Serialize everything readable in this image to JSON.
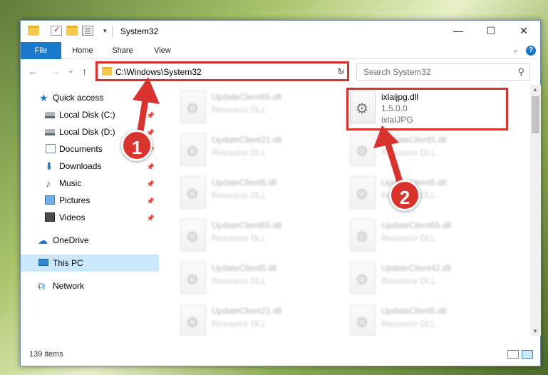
{
  "window": {
    "title": "System32",
    "controls": {
      "minimize": "—",
      "maximize": "☐",
      "close": "✕"
    }
  },
  "ribbon": {
    "tabs": [
      "File",
      "Home",
      "Share",
      "View"
    ],
    "expand": "⌄",
    "help": "?"
  },
  "navigation": {
    "back": "←",
    "forward": "→",
    "recent": "⌄",
    "up": "↑",
    "address": "C:\\Windows\\System32",
    "address_dropdown": "⌄",
    "refresh": "↻",
    "search_placeholder": "Search System32",
    "search_icon": "⚲"
  },
  "sidebar": {
    "items": [
      {
        "label": "Quick access",
        "icon": "star-icon",
        "glyph": "★"
      },
      {
        "label": "Local Disk (C:)",
        "icon": "disk-icon",
        "glyph": ""
      },
      {
        "label": "Local Disk (D:)",
        "icon": "disk-icon",
        "glyph": ""
      },
      {
        "label": "Documents",
        "icon": "document-icon",
        "glyph": ""
      },
      {
        "label": "Downloads",
        "icon": "download-icon",
        "glyph": "⬇"
      },
      {
        "label": "Music",
        "icon": "music-icon",
        "glyph": "♪"
      },
      {
        "label": "Pictures",
        "icon": "picture-icon",
        "glyph": ""
      },
      {
        "label": "Videos",
        "icon": "video-icon",
        "glyph": ""
      },
      {
        "label": "OneDrive",
        "icon": "cloud-icon",
        "glyph": "☁"
      },
      {
        "label": "This PC",
        "icon": "computer-icon",
        "glyph": ""
      },
      {
        "label": "Network",
        "icon": "network-icon",
        "glyph": "⧉"
      }
    ],
    "pin_glyph": "📌"
  },
  "files": {
    "selected": {
      "name": "ixlaijpg.dll",
      "version": "1.5.0.0",
      "description": "ixlaIJPG"
    },
    "left_column": [
      {
        "name": "UpdateClient65.dll",
        "type": "Resource DLL"
      },
      {
        "name": "UpdateClient21.dll",
        "type": "Resource DLL"
      },
      {
        "name": "UpdateClient5.dll",
        "type": "Resource DLL"
      },
      {
        "name": "UpdateClient65.dll",
        "type": "Resource DLL"
      },
      {
        "name": "UpdateClient5.dll",
        "type": "Resource DLL"
      },
      {
        "name": "UpdateClient21.dll",
        "type": "Resource DLL"
      }
    ],
    "right_column": [
      {
        "name": "UpdateClient5.dll",
        "type": "Resource DLL"
      },
      {
        "name": "UpdateClient5.dll",
        "type": "Resource DLL"
      },
      {
        "name": "UpdateClient65.dll",
        "type": "Resource DLL"
      },
      {
        "name": "UpdateClient42.dll",
        "type": "Resource DLL"
      },
      {
        "name": "UpdateClient5.dll",
        "type": "Resource DLL"
      }
    ]
  },
  "status": {
    "item_count": "139 items"
  },
  "annotations": {
    "marker_1": "1",
    "marker_2": "2",
    "color": "#d9332e"
  },
  "colors": {
    "accent": "#1979ca",
    "selection": "#cce8ff"
  }
}
